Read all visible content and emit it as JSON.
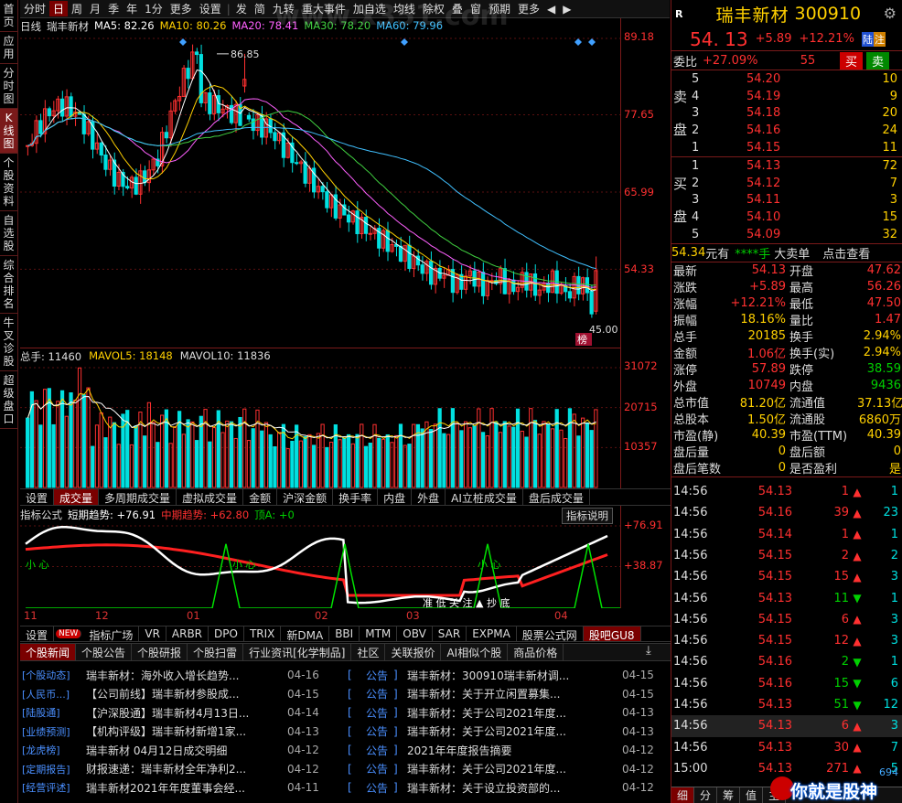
{
  "leftnav": [
    "首页",
    "应用",
    "分时图",
    "K线图",
    "个股资料",
    "自选股",
    "综合排名",
    "牛叉诊股",
    "超级盘口"
  ],
  "toolbar": [
    "分时",
    "日",
    "周",
    "月",
    "季",
    "年",
    "1分",
    "更多",
    "设置",
    "发",
    "简",
    "九转",
    "重大事件",
    "加自选",
    "均线",
    "除权",
    "叠",
    "窗",
    "预期",
    "更多",
    "◀",
    "▶"
  ],
  "main": {
    "title": "日线",
    "name": "瑞丰新材",
    "ma5": "MA5: 82.26",
    "ma10": "MA10: 80.26",
    "ma20": "MA20: 78.41",
    "ma30": "MA30: 78.20",
    "ma60": "MA60: 79.96",
    "high_label": "86.85",
    "low_label": "45.00",
    "bang": "榜",
    "price_ticks": [
      "89.18",
      "77.65",
      "65.99",
      "54.33"
    ]
  },
  "volume": {
    "legend_total": "总手: 11460",
    "legend_mavol5": "MAVOL5: 18148",
    "legend_mavol10": "MAVOL10: 11836",
    "ticks": [
      "31072",
      "20715",
      "10357"
    ]
  },
  "tabs1": [
    "设置",
    "成交量",
    "多周期成交量",
    "虚拟成交量",
    "金额",
    "沪深金额",
    "换手率",
    "内盘",
    "外盘",
    "AI立桩成交量",
    "盘后成交量"
  ],
  "indicator": {
    "name": "指标公式",
    "short": "短期趋势: +76.91",
    "mid": "中期趋势: +62.80",
    "top": "顶A: +0",
    "help": "指标说明",
    "ticks": [
      "+76.91",
      "+38.87"
    ],
    "small1": "小 心",
    "small2": "小 心",
    "small3": "小 心",
    "bottom_text": "准 低 关 注 ▲ 抄 底",
    "months": [
      "11",
      "12",
      "01",
      "02",
      "03",
      "04"
    ]
  },
  "tabs2": [
    "设置",
    "NEW",
    "指标广场",
    "VR",
    "ARBR",
    "DPO",
    "TRIX",
    "新DMA",
    "BBI",
    "MTM",
    "OBV",
    "SAR",
    "EXPMA",
    "股票公式网",
    "股吧GU8"
  ],
  "newstabs": [
    "个股新闻",
    "个股公告",
    "个股研报",
    "个股扫雷",
    "行业资讯[化学制品]",
    "社区",
    "关联报价",
    "AI相似个股",
    "商品价格"
  ],
  "news_left": [
    [
      "[个股动态]",
      "瑞丰新材：海外收入增长趋势...",
      "04-16"
    ],
    [
      "[人民币...]",
      "【公司前线】瑞丰新材参股成...",
      "04-15"
    ],
    [
      "[陆股通]",
      "【沪深股通】瑞丰新材4月13日...",
      "04-14"
    ],
    [
      "[业绩预测]",
      "【机构评级】瑞丰新材新增1家...",
      "04-13"
    ],
    [
      "[龙虎榜]",
      "瑞丰新材 04月12日成交明细",
      "04-12"
    ],
    [
      "[定期报告]",
      "财报速递：瑞丰新材全年净利2...",
      "04-12"
    ],
    [
      "[经营评述]",
      "瑞丰新材2021年年度董事会经...",
      "04-11"
    ]
  ],
  "news_right": [
    [
      "[",
      "公告",
      "]",
      "瑞丰新材：300910瑞丰新材调...",
      "04-15"
    ],
    [
      "[",
      "公告",
      "]",
      "瑞丰新材：关于开立闲置募集...",
      "04-15"
    ],
    [
      "[",
      "公告",
      "]",
      "瑞丰新材：关于公司2021年度...",
      "04-13"
    ],
    [
      "[",
      "公告",
      "]",
      "瑞丰新材：关于公司2021年度...",
      "04-13"
    ],
    [
      "[",
      "公告",
      "]",
      "2021年年度报告摘要",
      "04-12"
    ],
    [
      "[",
      "公告",
      "]",
      "瑞丰新材：关于公司2021年度...",
      "04-12"
    ],
    [
      "[",
      "公告",
      "]",
      "瑞丰新材：关于设立投资部的...",
      "04-12"
    ]
  ],
  "quote": {
    "badge": "R",
    "name": "瑞丰新材",
    "code": "300910",
    "price": "54. 13",
    "chg": "+5.89",
    "pct": "+12.21%",
    "tag1": "陆",
    "tag2": "注",
    "weibi_label": "委比",
    "weibi": "+27.09%",
    "weicha": "55",
    "buy": "买",
    "sell": "卖"
  },
  "asks": [
    [
      "5",
      "54.20",
      "10"
    ],
    [
      "4",
      "54.19",
      "9"
    ],
    [
      "3",
      "54.18",
      "20"
    ],
    [
      "2",
      "54.16",
      "24"
    ],
    [
      "1",
      "54.15",
      "11"
    ]
  ],
  "bids": [
    [
      "1",
      "54.13",
      "72"
    ],
    [
      "2",
      "54.12",
      "7"
    ],
    [
      "3",
      "54.11",
      "3"
    ],
    [
      "4",
      "54.10",
      "15"
    ],
    [
      "5",
      "54.09",
      "32"
    ]
  ],
  "ask_label": [
    "卖",
    "盘"
  ],
  "bid_label": [
    "买",
    "盘"
  ],
  "strip": {
    "price": "54.34",
    "unit": "元有",
    "stars": "****手",
    "big": "大卖单",
    "check": "点击查看"
  },
  "stats": [
    [
      "最新",
      "54.13",
      "开盘",
      "47.62"
    ],
    [
      "涨跌",
      "+5.89",
      "最高",
      "56.26"
    ],
    [
      "涨幅",
      "+12.21%",
      "最低",
      "47.50"
    ],
    [
      "振幅",
      "18.16%",
      "量比",
      "1.47"
    ],
    [
      "总手",
      "20185",
      "换手",
      "2.94%"
    ],
    [
      "金额",
      "1.06亿",
      "换手(实)",
      "2.94%"
    ],
    [
      "涨停",
      "57.89",
      "跌停",
      "38.59"
    ],
    [
      "外盘",
      "10749",
      "内盘",
      "9436"
    ],
    [
      "总市值",
      "81.20亿",
      "流通值",
      "37.13亿"
    ],
    [
      "总股本",
      "1.50亿",
      "流通股",
      "6860万"
    ],
    [
      "市盈(静)",
      "40.39",
      "市盈(TTM)",
      "40.39"
    ],
    [
      "盘后量",
      "0",
      "盘后额",
      "0"
    ],
    [
      "盘后笔数",
      "0",
      "是否盈利",
      "是"
    ]
  ],
  "ticks": [
    [
      "14:56",
      "54.13",
      "1",
      "up",
      "1"
    ],
    [
      "14:56",
      "54.16",
      "39",
      "up",
      "23"
    ],
    [
      "14:56",
      "54.14",
      "1",
      "up",
      "1"
    ],
    [
      "14:56",
      "54.15",
      "2",
      "up",
      "2"
    ],
    [
      "14:56",
      "54.15",
      "15",
      "up",
      "3"
    ],
    [
      "14:56",
      "54.13",
      "11",
      "dn",
      "1"
    ],
    [
      "14:56",
      "54.15",
      "6",
      "up",
      "3"
    ],
    [
      "14:56",
      "54.15",
      "12",
      "up",
      "3"
    ],
    [
      "14:56",
      "54.16",
      "2",
      "dn",
      "1"
    ],
    [
      "14:56",
      "54.16",
      "15",
      "dn",
      "6"
    ],
    [
      "14:56",
      "54.13",
      "51",
      "dn",
      "12"
    ],
    [
      "14:56",
      "54.13",
      "6",
      "up",
      "3"
    ],
    [
      "14:56",
      "54.13",
      "30",
      "up",
      "7"
    ],
    [
      "15:00",
      "54.13",
      "271",
      "up",
      "5"
    ]
  ],
  "bottomtabs": [
    "细",
    "分",
    "筹",
    "值",
    "主"
  ],
  "watermark": "www.x351.com",
  "logo": "你就是股神",
  "logo_num": "694"
}
